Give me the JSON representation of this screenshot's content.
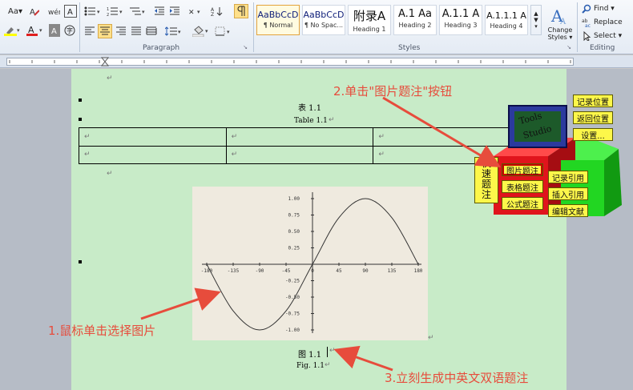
{
  "ribbon": {
    "font_group": {
      "change_case": "Aa▾"
    },
    "paragraph_group_label": "Paragraph",
    "styles_group_label": "Styles",
    "editing_group_label": "Editing",
    "styles": [
      {
        "preview": "AaBbCcD",
        "name": "¶ Normal"
      },
      {
        "preview": "AaBbCcD",
        "name": "¶ No Spac..."
      },
      {
        "preview": "附录A",
        "name": "Heading 1"
      },
      {
        "preview": "A.1  Aa",
        "name": "Heading 2"
      },
      {
        "preview": "A.1.1  A",
        "name": "Heading 3"
      },
      {
        "preview": "A.1.1.1  A",
        "name": "Heading 4"
      }
    ],
    "change_styles_label": "Change Styles ▾",
    "find_label": "Find ▾",
    "replace_label": "Replace",
    "select_label": "Select ▾"
  },
  "document": {
    "table_caption_cn": "表 1.1",
    "table_caption_en": "Table 1.1",
    "figure_caption_cn": "图 1.1",
    "figure_caption_en": "Fig. 1.1",
    "para_mark": "↵"
  },
  "chart_data": {
    "type": "line",
    "series": [
      {
        "x": [
          -180,
          -135,
          -90,
          -45,
          0,
          45,
          90,
          135,
          180
        ],
        "values": [
          0,
          -0.71,
          -1.0,
          -0.71,
          0,
          0.71,
          1.0,
          0.71,
          0
        ]
      }
    ],
    "x_ticks": [
      "-180",
      "-135",
      "-90",
      "-45",
      "0",
      "45",
      "90",
      "135",
      "180"
    ],
    "y_ticks": [
      "1.00",
      "0.75",
      "0.50",
      "0.25",
      "-0.25",
      "-0.50",
      "-0.75",
      "-1.00"
    ],
    "xlim": [
      -180,
      180
    ],
    "ylim": [
      -1,
      1
    ]
  },
  "annotations": {
    "step1": "1.鼠标单击选择图片",
    "step2": "2.单击\"图片题注\"按钮",
    "step3": "3.立刻生成中英文双语题注"
  },
  "macro_panel": {
    "quick_caption": [
      "快",
      "速",
      "题",
      "注"
    ],
    "figure_caption_btn": "图片题注",
    "table_caption_btn": "表格题注",
    "equation_caption_btn": "公式题注",
    "record_position_btn": "记录位置",
    "return_position_btn": "返回位置",
    "settings_btn": "设置...",
    "record_ref_btn": "记录引用",
    "insert_ref_btn": "插入引用",
    "edit_bib_btn": "编辑文献",
    "logo_text": "Tools Studio"
  },
  "colors": {
    "page_bg": "#c8ebc8",
    "annotation": "#e74c3c",
    "macro_button": "#fdf74a",
    "box_red": "#e0141c",
    "box_green": "#22d622"
  }
}
